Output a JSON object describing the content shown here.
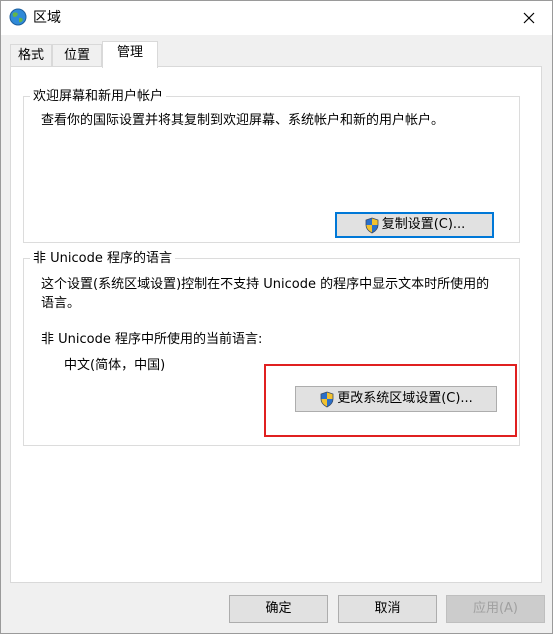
{
  "window": {
    "title": "区域",
    "close_glyph": "✕"
  },
  "tabs": [
    {
      "label": "格式",
      "active": false
    },
    {
      "label": "位置",
      "active": false
    },
    {
      "label": "管理",
      "active": true
    }
  ],
  "welcome_group": {
    "legend": "欢迎屏幕和新用户帐户",
    "description": "查看你的国际设置并将其复制到欢迎屏幕、系统帐户和新的用户帐户。",
    "copy_button": "复制设置(C)..."
  },
  "unicode_group": {
    "legend": "非 Unicode 程序的语言",
    "description_line1": "这个设置(系统区域设置)控制在不支持 Unicode 的程序中显示文本时所使用的",
    "description_line2": "语言。",
    "current_label": "非 Unicode 程序中所使用的当前语言:",
    "current_value": "中文(简体，中国)",
    "change_button": "更改系统区域设置(C)..."
  },
  "footer": {
    "ok": "确定",
    "cancel": "取消",
    "apply": "应用(A)"
  },
  "colors": {
    "highlight": "#e02020",
    "default_button_border": "#0078d7"
  },
  "icons": {
    "app": "globe-icon",
    "close": "close-icon",
    "uac": "uac-shield-icon"
  }
}
